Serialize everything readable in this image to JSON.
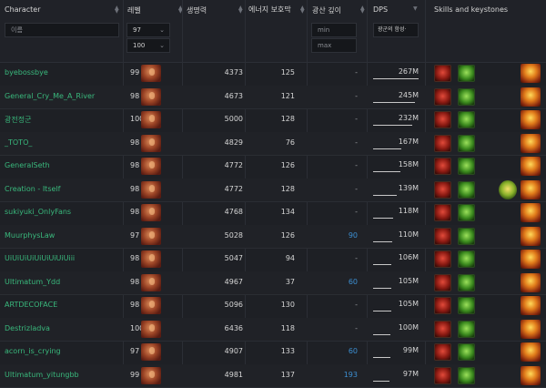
{
  "columns": {
    "character": "Character",
    "level": "레벨",
    "life": "생명력",
    "energy_shield": "에너지 보호막",
    "ward": "광산 깊이",
    "dps": "DPS",
    "skills": "Skills and keystones"
  },
  "filters": {
    "name_placeholder": "이름",
    "level_min": "97",
    "level_max": "100",
    "depth_min_placeholder": "min",
    "depth_max_placeholder": "max",
    "dps_select": "광군의 함성·"
  },
  "dps_max": 267,
  "rows": [
    {
      "name": "byebossbye",
      "level": "99",
      "life": "4373",
      "es": "125",
      "depth": "-",
      "dps": "267M",
      "dps_value": 267
    },
    {
      "name": "General_Cry_Me_A_River",
      "level": "98",
      "life": "4673",
      "es": "121",
      "depth": "-",
      "dps": "245M",
      "dps_value": 245
    },
    {
      "name": "광전정군",
      "level": "100",
      "life": "5000",
      "es": "128",
      "depth": "-",
      "dps": "232M",
      "dps_value": 232
    },
    {
      "name": "_TOTO_",
      "level": "98",
      "life": "4829",
      "es": "76",
      "depth": "-",
      "dps": "167M",
      "dps_value": 167
    },
    {
      "name": "GeneralSeth",
      "level": "98",
      "life": "4772",
      "es": "126",
      "depth": "-",
      "dps": "158M",
      "dps_value": 158
    },
    {
      "name": "Creation - Itself",
      "level": "98",
      "life": "4772",
      "es": "128",
      "depth": "-",
      "dps": "139M",
      "dps_value": 139
    },
    {
      "name": "sukiyuki_OnlyFans",
      "level": "98",
      "life": "4768",
      "es": "134",
      "depth": "-",
      "dps": "118M",
      "dps_value": 118
    },
    {
      "name": "MuurphysLaw",
      "level": "97",
      "life": "5028",
      "es": "126",
      "depth": "90",
      "dps": "110M",
      "dps_value": 110
    },
    {
      "name": "UiUiUiUiUiUiUiUiUiii",
      "level": "98",
      "life": "5047",
      "es": "94",
      "depth": "-",
      "dps": "106M",
      "dps_value": 106
    },
    {
      "name": "Ultimatum_Ydd",
      "level": "98",
      "life": "4967",
      "es": "37",
      "depth": "60",
      "dps": "105M",
      "dps_value": 105
    },
    {
      "name": "ARTDECOFACE",
      "level": "98",
      "life": "5096",
      "es": "130",
      "depth": "-",
      "dps": "105M",
      "dps_value": 105
    },
    {
      "name": "Destrizladva",
      "level": "100",
      "life": "6436",
      "es": "118",
      "depth": "-",
      "dps": "100M",
      "dps_value": 100
    },
    {
      "name": "acorn_is_crying",
      "level": "97",
      "life": "4907",
      "es": "133",
      "depth": "60",
      "dps": "99M",
      "dps_value": 99
    },
    {
      "name": "Ultimatum_yitungbb",
      "level": "99",
      "life": "4981",
      "es": "137",
      "depth": "193",
      "dps": "97M",
      "dps_value": 97
    }
  ]
}
